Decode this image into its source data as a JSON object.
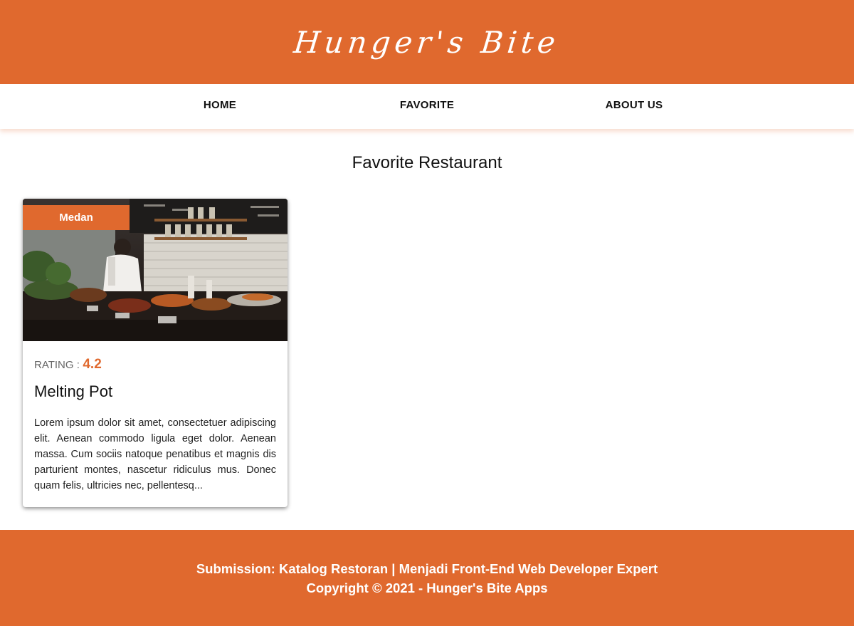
{
  "header": {
    "title": "Hunger's Bite"
  },
  "nav": {
    "items": [
      {
        "label": "HOME"
      },
      {
        "label": "FAVORITE"
      },
      {
        "label": "ABOUT US"
      }
    ]
  },
  "main": {
    "page_title": "Favorite Restaurant",
    "restaurants": [
      {
        "city": "Medan",
        "rating_label": "RATING :",
        "rating": "4.2",
        "name": "Melting Pot",
        "description": "Lorem ipsum dolor sit amet, consectetuer adipiscing elit. Aenean commodo ligula eget dolor. Aenean massa. Cum sociis natoque penatibus et magnis dis parturient montes, nascetur ridiculus mus. Donec quam felis, ultricies nec, pellentesq..."
      }
    ]
  },
  "footer": {
    "line1": "Submission: Katalog Restoran | Menjadi Front-End Web Developer Expert",
    "line2": "Copyright © 2021 - Hunger's Bite Apps"
  },
  "colors": {
    "accent": "#e0692e",
    "background": "#ffffff"
  }
}
